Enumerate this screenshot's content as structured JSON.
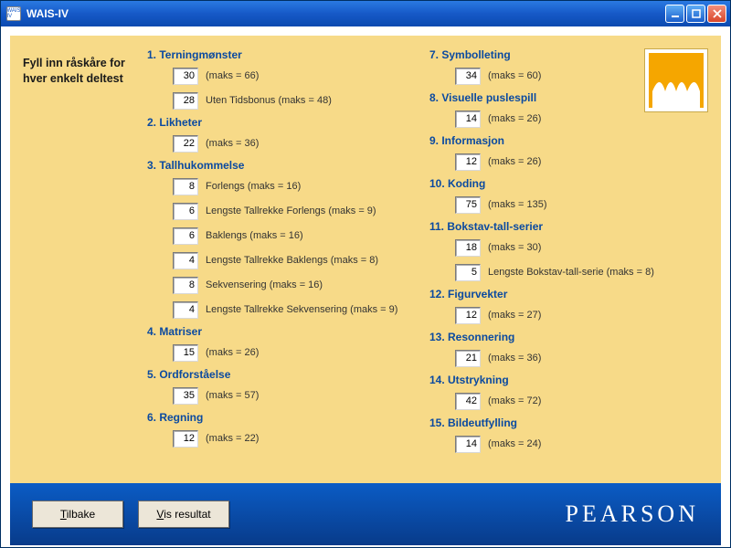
{
  "window": {
    "app_icon_text": "WAIS IV",
    "title": "WAIS-IV"
  },
  "instruction": "Fyll inn råskåre for hver enkelt deltest",
  "footer": {
    "back": "Tilbake",
    "show": "Vis resultat",
    "brand": "PEARSON"
  },
  "left": [
    {
      "title": "1. Terningmønster",
      "rows": [
        {
          "value": "30",
          "desc": "(maks = 66)"
        },
        {
          "value": "28",
          "desc": "Uten Tidsbonus (maks = 48)"
        }
      ]
    },
    {
      "title": "2. Likheter",
      "rows": [
        {
          "value": "22",
          "desc": "(maks = 36)"
        }
      ]
    },
    {
      "title": "3. Tallhukommelse",
      "rows": [
        {
          "value": "8",
          "desc": "Forlengs (maks = 16)"
        },
        {
          "value": "6",
          "desc": "Lengste Tallrekke Forlengs (maks = 9)"
        },
        {
          "value": "6",
          "desc": "Baklengs (maks = 16)"
        },
        {
          "value": "4",
          "desc": "Lengste Tallrekke Baklengs (maks = 8)"
        },
        {
          "value": "8",
          "desc": "Sekvensering (maks = 16)"
        },
        {
          "value": "4",
          "desc": "Lengste Tallrekke Sekvensering (maks = 9)"
        }
      ]
    },
    {
      "title": "4. Matriser",
      "rows": [
        {
          "value": "15",
          "desc": "(maks = 26)"
        }
      ]
    },
    {
      "title": "5. Ordforståelse",
      "rows": [
        {
          "value": "35",
          "desc": "(maks = 57)"
        }
      ]
    },
    {
      "title": "6. Regning",
      "rows": [
        {
          "value": "12",
          "desc": "(maks = 22)"
        }
      ]
    }
  ],
  "right": [
    {
      "title": "7. Symbolleting",
      "rows": [
        {
          "value": "34",
          "desc": "(maks = 60)"
        }
      ]
    },
    {
      "title": "8. Visuelle puslespill",
      "rows": [
        {
          "value": "14",
          "desc": "(maks = 26)"
        }
      ]
    },
    {
      "title": "9. Informasjon",
      "rows": [
        {
          "value": "12",
          "desc": "(maks = 26)"
        }
      ]
    },
    {
      "title": "10. Koding",
      "rows": [
        {
          "value": "75",
          "desc": "(maks = 135)"
        }
      ]
    },
    {
      "title": "11. Bokstav-tall-serier",
      "rows": [
        {
          "value": "18",
          "desc": "(maks = 30)"
        },
        {
          "value": "5",
          "desc": "Lengste Bokstav-tall-serie (maks = 8)"
        }
      ]
    },
    {
      "title": "12. Figurvekter",
      "rows": [
        {
          "value": "12",
          "desc": "(maks = 27)"
        }
      ]
    },
    {
      "title": "13. Resonnering",
      "rows": [
        {
          "value": "21",
          "desc": "(maks = 36)"
        }
      ]
    },
    {
      "title": "14. Utstrykning",
      "rows": [
        {
          "value": "42",
          "desc": "(maks = 72)"
        }
      ]
    },
    {
      "title": "15. Bildeutfylling",
      "rows": [
        {
          "value": "14",
          "desc": "(maks = 24)"
        }
      ]
    }
  ]
}
